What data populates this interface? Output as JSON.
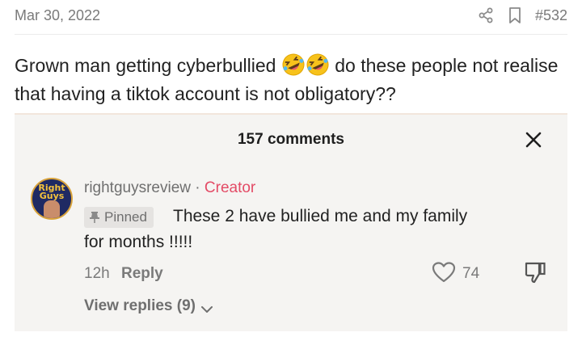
{
  "post": {
    "date": "Mar 30, 2022",
    "number": "#532",
    "text_before": "Grown man getting cyberbullied ",
    "text_after": " do these people not realise that having a tiktok account is not obligatory??",
    "emoji": "rolling-on-floor-laughing"
  },
  "icons": {
    "share": "share-icon",
    "bookmark": "bookmark-icon",
    "close": "close-icon",
    "pin": "pin-icon",
    "heart": "heart-icon",
    "dislike": "thumbs-down-icon",
    "chevron": "chevron-down-icon"
  },
  "screenshot": {
    "title": "157 comments",
    "comment": {
      "avatar_text_1": "Right",
      "avatar_text_2": "Guys",
      "username": "rightguysreview",
      "separator": " · ",
      "creator_label": "Creator",
      "pinned_label": "Pinned",
      "text": "These 2 have bullied me and my family for months !!!!!",
      "time": "12h",
      "reply_label": "Reply",
      "likes": "74",
      "view_replies": "View replies (9)"
    }
  },
  "colors": {
    "creator": "#e34b66",
    "muted": "#7a7a7a",
    "card_bg": "#f5f4f2"
  }
}
